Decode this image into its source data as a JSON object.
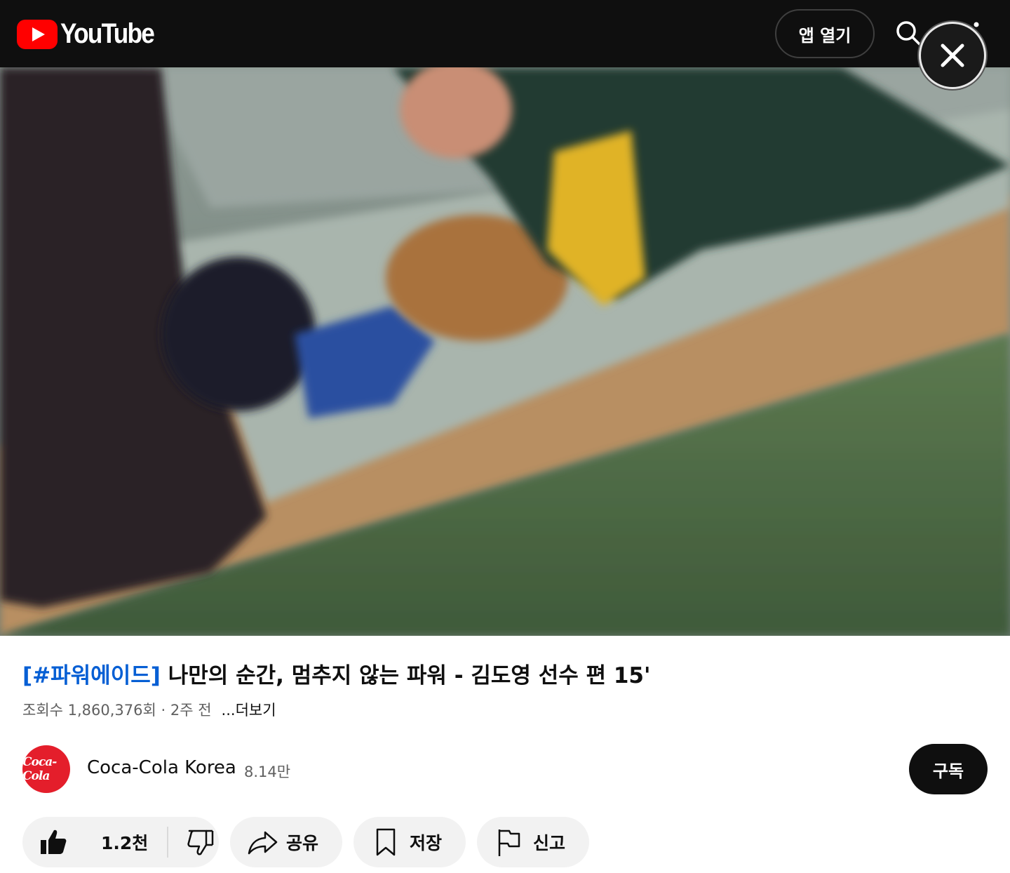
{
  "header": {
    "logo_text": "YouTube",
    "open_app_label": "앱 열기"
  },
  "video": {
    "title_hashtag": "[#파워에이드]",
    "title_rest": " 나만의 순간, 멈추지 않는 파워 - 김도영 선수 편 15'",
    "views": "조회수 1,860,376회 · 2주 전",
    "more_label": "...더보기"
  },
  "channel": {
    "avatar_text": "Coca-Cola",
    "name": "Coca-Cola Korea",
    "subscribers": "8.14만",
    "subscribe_label": "구독"
  },
  "actions": {
    "like_count": "1.2천",
    "share_label": "공유",
    "save_label": "저장",
    "report_label": "신고"
  },
  "colors": {
    "brand_red": "#ff0000",
    "hashtag_blue": "#065fd4",
    "coke_red": "#e41e2b"
  }
}
